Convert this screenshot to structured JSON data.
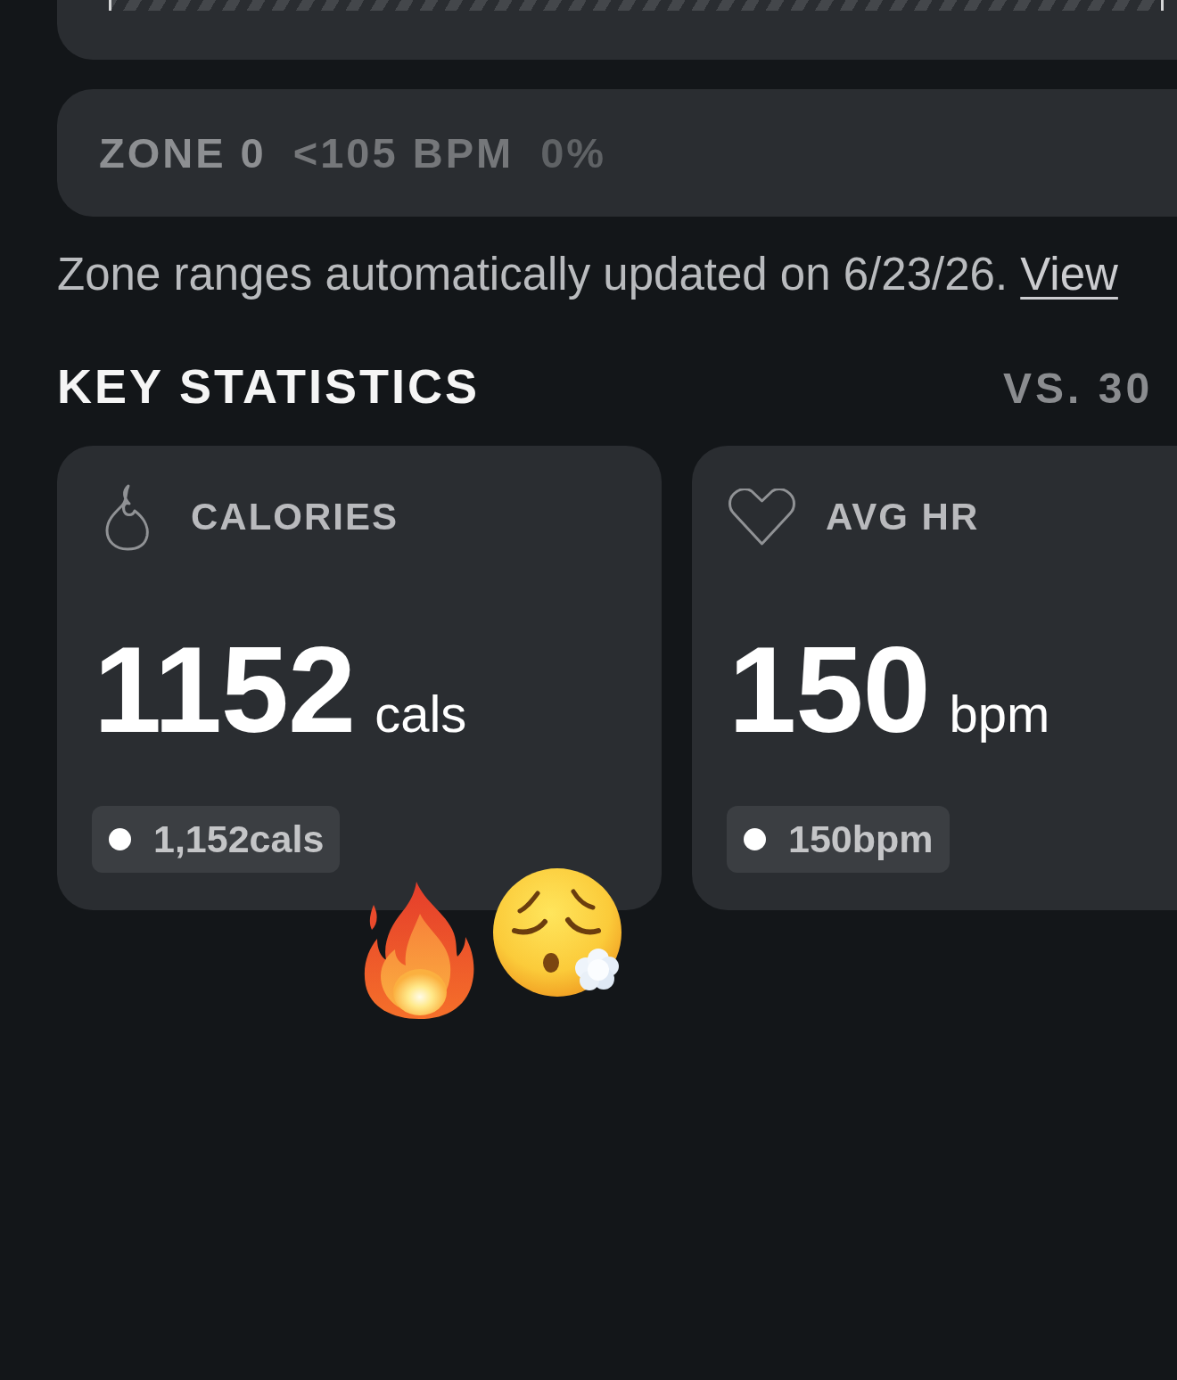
{
  "zone_row": {
    "label": "ZONE 0",
    "range": "<105 BPM",
    "percent": "0%"
  },
  "note": {
    "text": "Zone ranges automatically updated on 6/23/26.",
    "link": "View"
  },
  "key_statistics": {
    "title": "KEY STATISTICS",
    "comparison": "VS. 30",
    "cards": [
      {
        "kind": "calories",
        "label": "CALORIES",
        "value": "1152",
        "unit": "cals",
        "chip": "1,152cals"
      },
      {
        "kind": "heart_rate",
        "label": "AVG HR",
        "value": "150",
        "unit": "bpm",
        "chip": "150bpm"
      }
    ]
  }
}
